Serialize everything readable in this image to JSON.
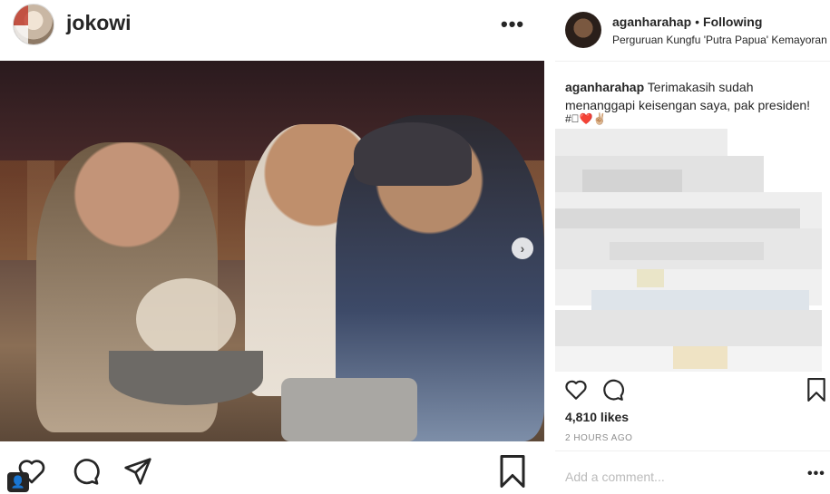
{
  "post": {
    "username": "jokowi",
    "more_label": "•••",
    "next_label": "›",
    "person_badge": "👤"
  },
  "sidebar": {
    "username": "aganharahap",
    "separator": "•",
    "follow_status": "Following",
    "location": "Perguruan Kungfu 'Putra Papua' Kemayoran",
    "caption_user": "aganharahap",
    "caption_text": "Terimakasih sudah menanggapi keisengan saya, pak presiden!",
    "caption_emojis": "#🏽❤️✌🏼",
    "likes": "4,810 likes",
    "time": "2 HOURS AGO",
    "comment_placeholder": "Add a comment...",
    "comment_more": "•••"
  },
  "icons": {
    "left_actions": [
      "heart-icon",
      "comment-icon",
      "share-icon",
      "bookmark-icon"
    ],
    "right_actions": [
      "heart-icon",
      "comment-icon",
      "bookmark-icon"
    ]
  },
  "colors": {
    "text": "#262626",
    "muted": "#8e8e8e",
    "placeholder": "#bbbbbb",
    "divider": "#efefef"
  }
}
